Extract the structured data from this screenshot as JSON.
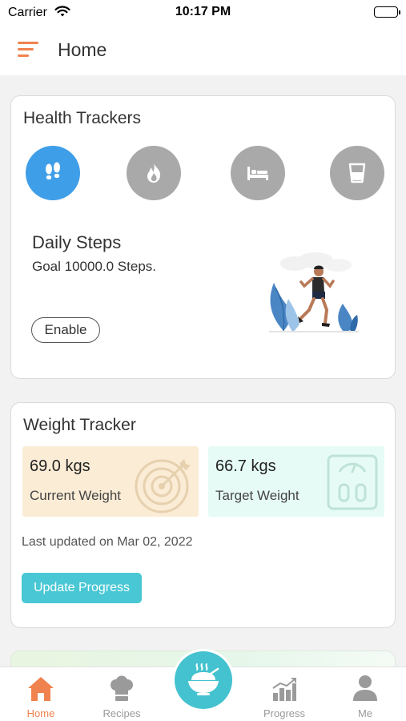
{
  "status_bar": {
    "carrier": "Carrier",
    "time": "10:17 PM",
    "icons": [
      "wifi-icon",
      "battery-icon"
    ]
  },
  "nav": {
    "title": "Home",
    "menu_icon": "menu-icon",
    "accent_color": "#f0824f"
  },
  "health_trackers": {
    "title": "Health Trackers",
    "trackers": [
      {
        "icon": "footsteps-icon",
        "active": true
      },
      {
        "icon": "flame-icon",
        "active": false
      },
      {
        "icon": "bed-icon",
        "active": false
      },
      {
        "icon": "glass-icon",
        "active": false
      }
    ],
    "active_color": "#3f9ee8",
    "inactive_color": "#a9a9a9",
    "selected": {
      "title": "Daily Steps",
      "goal": "Goal 10000.0 Steps.",
      "enable_label": "Enable",
      "illustration": "runner-illustration"
    }
  },
  "weight_tracker": {
    "title": "Weight Tracker",
    "current": {
      "value": "69.0 kgs",
      "label": "Current Weight",
      "icon": "target-icon",
      "color": "#fbecd6"
    },
    "target": {
      "value": "66.7 kgs",
      "label": "Target Weight",
      "icon": "scale-icon",
      "color": "#e6fbf5"
    },
    "last_updated": "Last updated on Mar 02, 2022",
    "update_label": "Update Progress",
    "button_color": "#49c7d4"
  },
  "tab_bar": {
    "tabs": [
      {
        "label": "Home",
        "icon": "home-icon",
        "active": true
      },
      {
        "label": "Recipes",
        "icon": "chef-hat-icon",
        "active": false
      },
      {
        "label": "Progress",
        "icon": "bar-chart-icon",
        "active": false
      },
      {
        "label": "Me",
        "icon": "person-icon",
        "active": false
      }
    ],
    "center_icon": "food-bowl-icon",
    "center_color": "#44c2cf"
  }
}
